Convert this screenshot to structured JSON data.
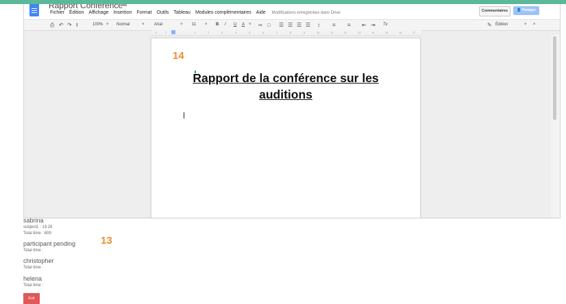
{
  "doc": {
    "title": "Rapport Conférence",
    "menu": [
      "Fichier",
      "Édition",
      "Affichage",
      "Insertion",
      "Format",
      "Outils",
      "Tableau",
      "Modules complémentaires",
      "Aide"
    ],
    "save_status": "Modifications enregistrées dans Drive",
    "comments_label": "Commentaires",
    "share_label": "Partager"
  },
  "toolbar": {
    "zoom": "100%",
    "style": "Normal",
    "font": "Arial",
    "size": "11",
    "bold": "B",
    "italic": "I",
    "underline": "U",
    "text_color": "A",
    "clear_format": "Tx",
    "mode": "Édition"
  },
  "ruler": [
    "2",
    "1",
    "1",
    "2",
    "3",
    "4",
    "5",
    "6",
    "7",
    "8",
    "9",
    "10",
    "11",
    "12",
    "13",
    "14",
    "15",
    "16",
    "17"
  ],
  "content": {
    "heading": "Rapport de la conférence sur les auditions"
  },
  "annotations": {
    "top": "14",
    "bottom": "13"
  },
  "participants": [
    {
      "name": "sabrina",
      "lines": [
        "subject1 : 13:29",
        "Total time : 809"
      ]
    },
    {
      "name": "participant pending",
      "lines": [
        "Total time :"
      ]
    },
    {
      "name": "christopher",
      "lines": [
        "Total time :"
      ]
    },
    {
      "name": "helena",
      "lines": [
        "Total time :"
      ]
    }
  ],
  "exit_label": "Exit",
  "colors": {
    "accent_bar": "#5cb89a",
    "docs_blue": "#4285f4",
    "annotation_orange": "#f08c2e",
    "exit_red": "#e0585a"
  },
  "icons": [
    "docs-logo-icon",
    "folder-icon",
    "print-icon",
    "undo-icon",
    "redo-icon",
    "paint-format-icon",
    "link-icon",
    "comment-icon",
    "align-left-icon",
    "align-center-icon",
    "align-right-icon",
    "justify-icon",
    "line-spacing-icon",
    "numbered-list-icon",
    "bulleted-list-icon",
    "decrease-indent-icon",
    "increase-indent-icon",
    "pencil-icon",
    "collapse-icon"
  ]
}
